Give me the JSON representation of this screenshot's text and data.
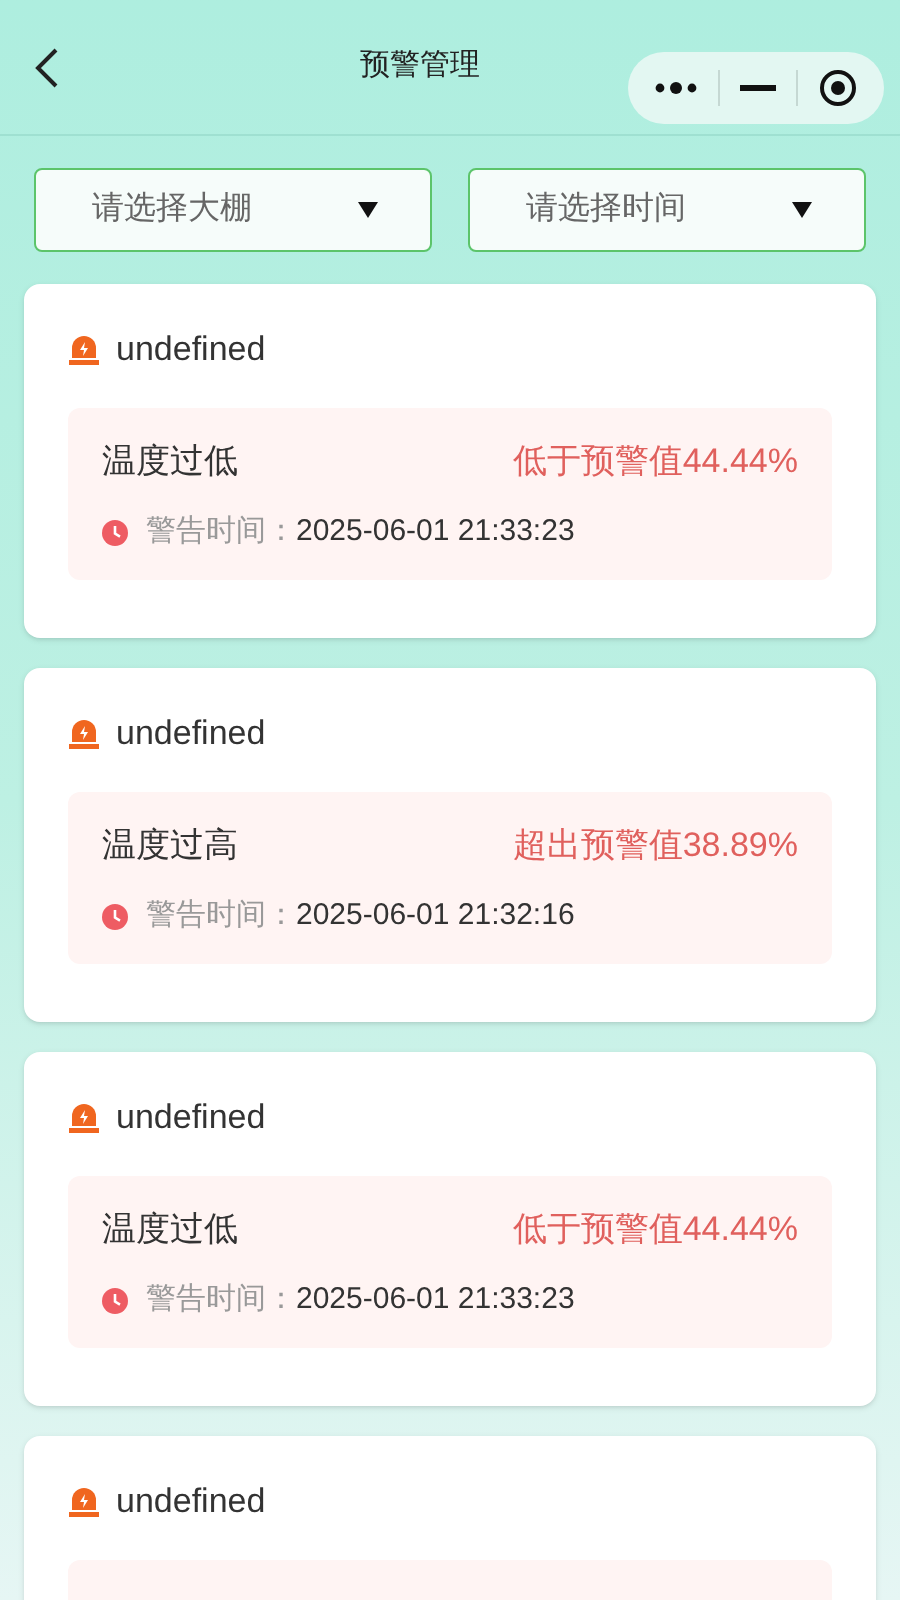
{
  "header": {
    "title": "预警管理"
  },
  "filters": [
    {
      "placeholder": "请选择大棚"
    },
    {
      "placeholder": "请选择时间"
    }
  ],
  "alerts": [
    {
      "name": "undefined",
      "type": "温度过低",
      "deviation": "低于预警值44.44%",
      "time_label": "警告时间：",
      "time": "2025-06-01 21:33:23"
    },
    {
      "name": "undefined",
      "type": "温度过高",
      "deviation": "超出预警值38.89%",
      "time_label": "警告时间：",
      "time": "2025-06-01 21:32:16"
    },
    {
      "name": "undefined",
      "type": "温度过低",
      "deviation": "低于预警值44.44%",
      "time_label": "警告时间：",
      "time": "2025-06-01 21:33:23"
    },
    {
      "name": "undefined"
    }
  ]
}
